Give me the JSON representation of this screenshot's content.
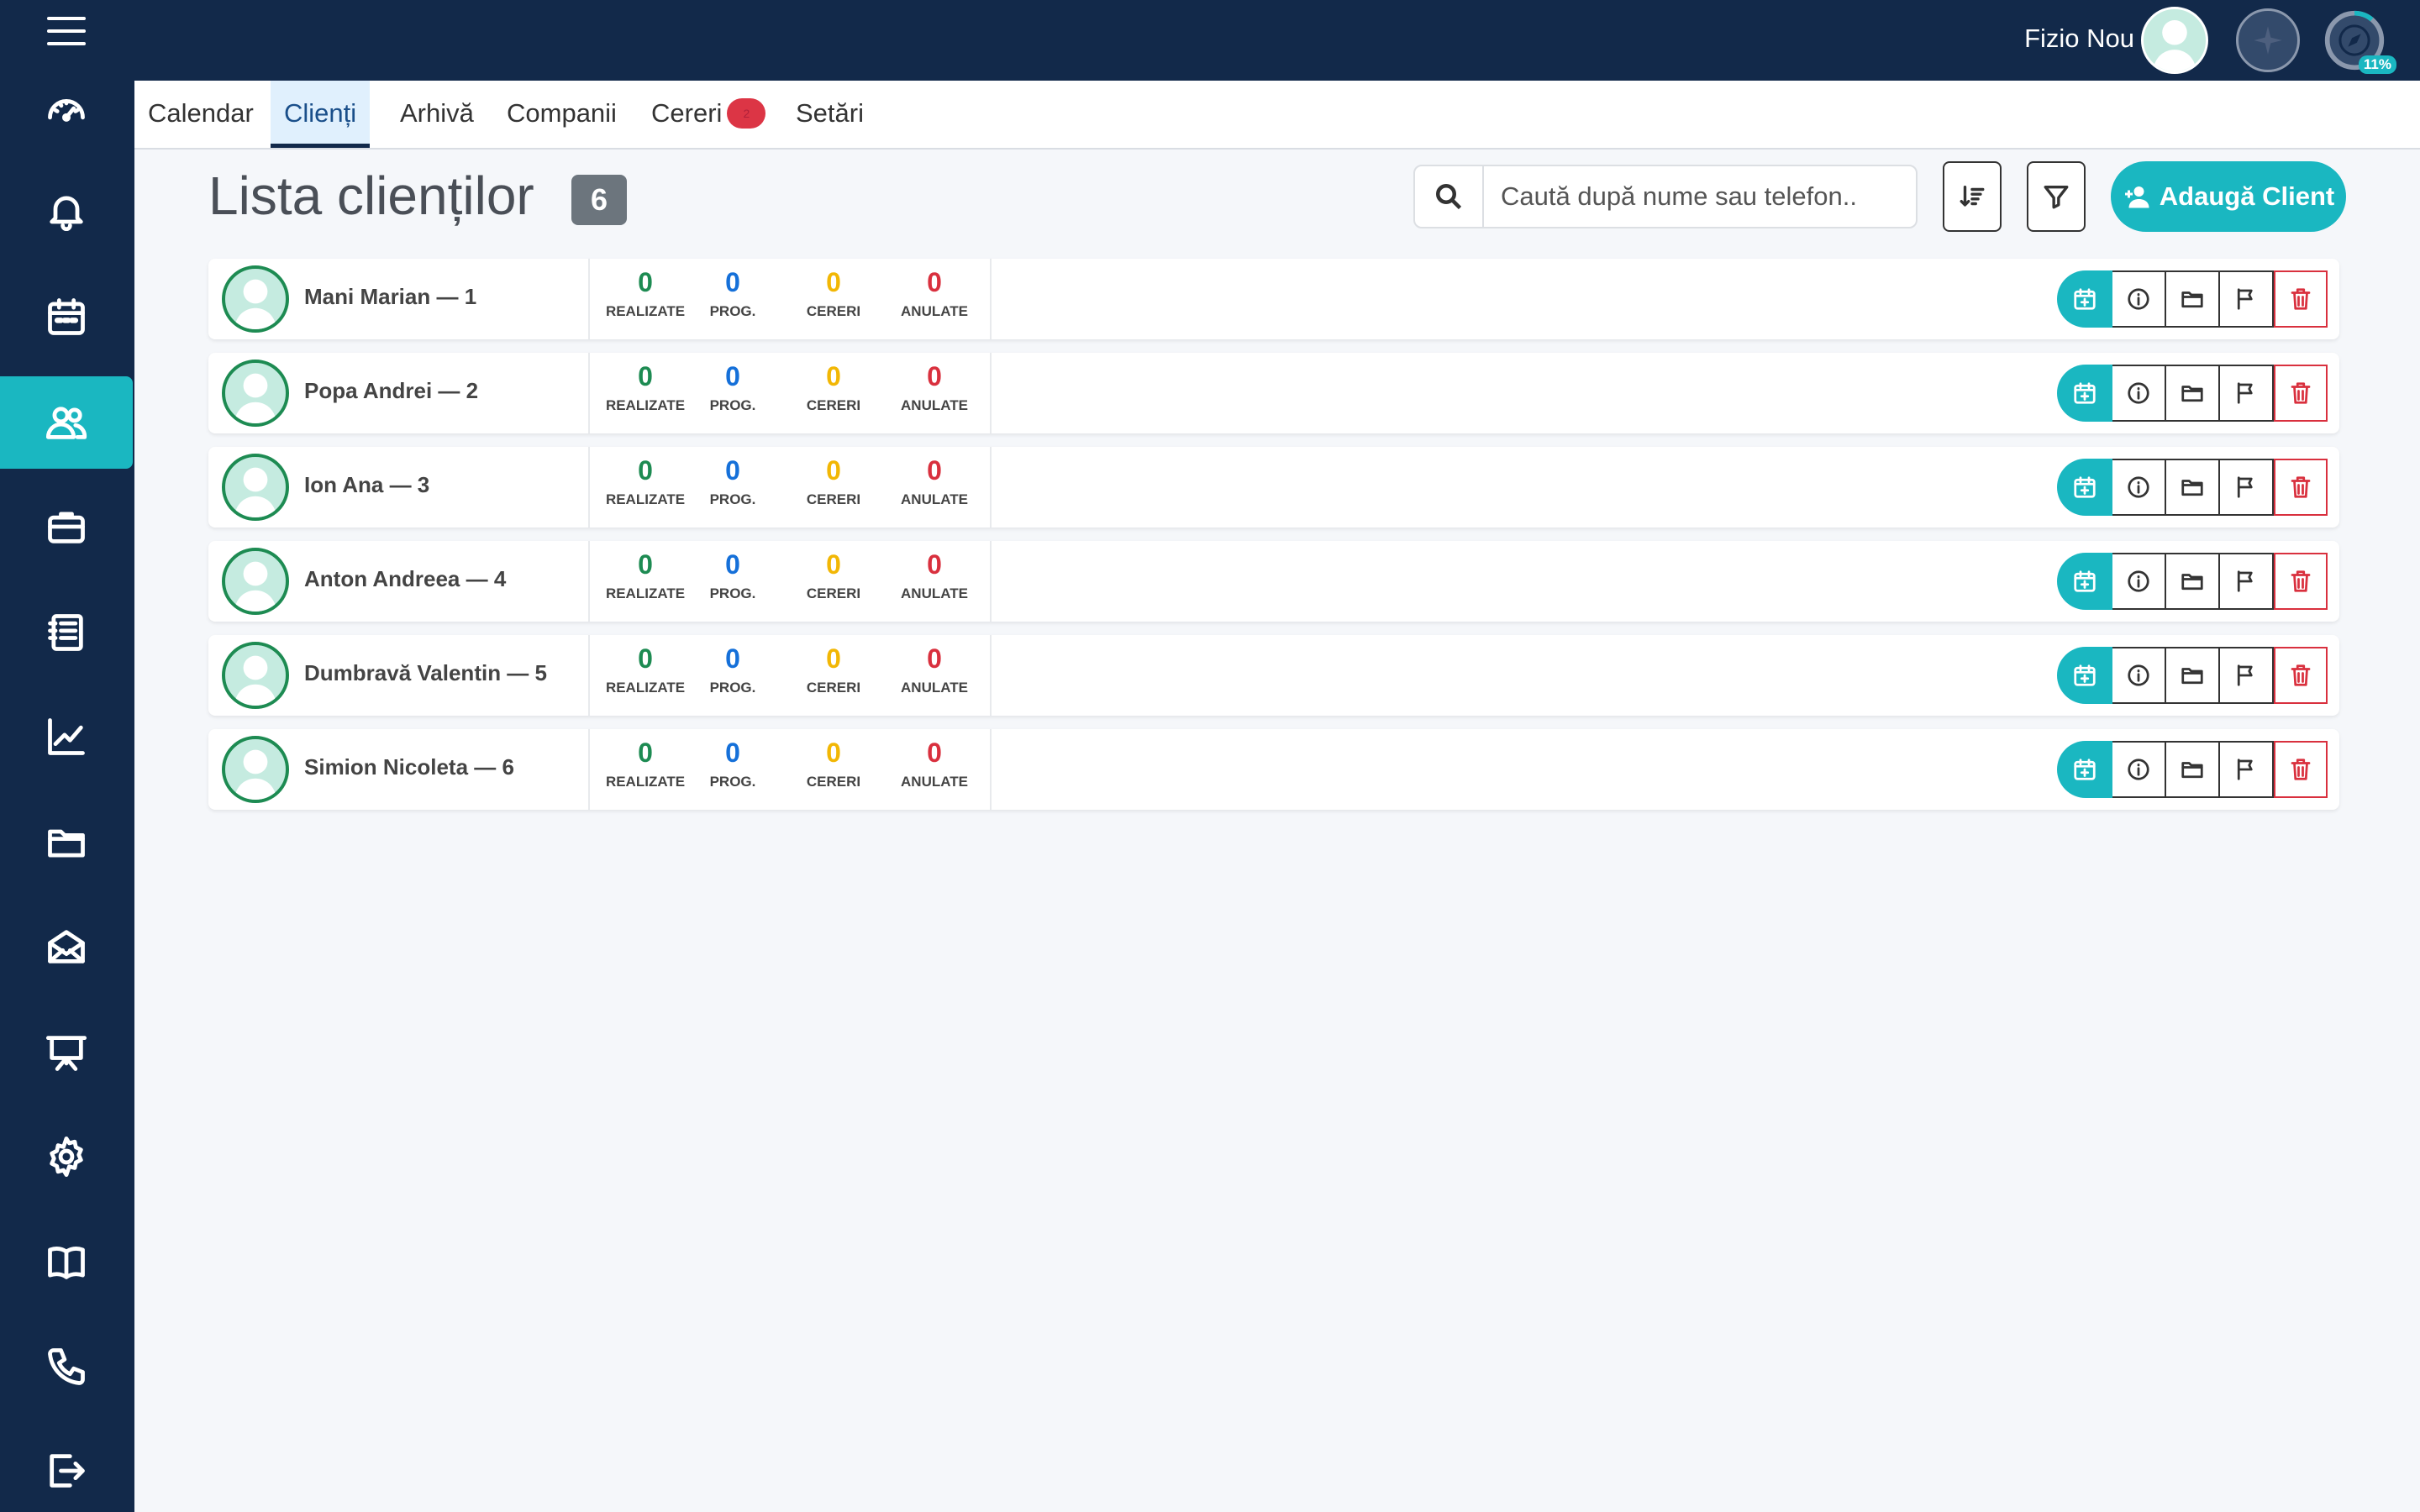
{
  "header": {
    "user_name": "Fizio Nou",
    "progress_percent": 11,
    "progress_label": "11%"
  },
  "sidebar": {
    "items": [
      {
        "name": "dashboard",
        "icon": "speedometer-icon"
      },
      {
        "name": "notifications",
        "icon": "bell-icon"
      },
      {
        "name": "calendar",
        "icon": "calendar-icon"
      },
      {
        "name": "clients",
        "icon": "people-icon",
        "active": true
      },
      {
        "name": "briefcase",
        "icon": "briefcase-icon"
      },
      {
        "name": "list",
        "icon": "list-icon"
      },
      {
        "name": "statistics",
        "icon": "chart-icon"
      },
      {
        "name": "files",
        "icon": "folder-icon"
      },
      {
        "name": "messages",
        "icon": "envelope-icon"
      },
      {
        "name": "presentation",
        "icon": "easel-icon"
      },
      {
        "name": "settings",
        "icon": "gear-icon"
      },
      {
        "name": "guide",
        "icon": "book-icon"
      },
      {
        "name": "contact",
        "icon": "phone-icon"
      },
      {
        "name": "logout",
        "icon": "logout-icon"
      }
    ]
  },
  "tabs": [
    {
      "label": "Calendar"
    },
    {
      "label": "Clienți",
      "active": true
    },
    {
      "label": "Arhivă"
    },
    {
      "label": "Companii"
    },
    {
      "label": "Cereri",
      "badge": "2"
    },
    {
      "label": "Setări"
    }
  ],
  "page": {
    "title": "Lista clienților",
    "count": "6",
    "search_placeholder": "Caută după nume sau telefon..",
    "add_button_label": "Adaugă Client"
  },
  "stat_labels": {
    "done": "REALIZATE",
    "scheduled": "PROG.",
    "requests": "CERERI",
    "cancelled": "ANULATE"
  },
  "clients": [
    {
      "name": "Mani Marian — 1",
      "done": "0",
      "scheduled": "0",
      "requests": "0",
      "cancelled": "0"
    },
    {
      "name": "Popa Andrei — 2",
      "done": "0",
      "scheduled": "0",
      "requests": "0",
      "cancelled": "0"
    },
    {
      "name": "Ion Ana — 3",
      "done": "0",
      "scheduled": "0",
      "requests": "0",
      "cancelled": "0"
    },
    {
      "name": "Anton Andreea — 4",
      "done": "0",
      "scheduled": "0",
      "requests": "0",
      "cancelled": "0"
    },
    {
      "name": "Dumbravă Valentin — 5",
      "done": "0",
      "scheduled": "0",
      "requests": "0",
      "cancelled": "0"
    },
    {
      "name": "Simion Nicoleta — 6",
      "done": "0",
      "scheduled": "0",
      "requests": "0",
      "cancelled": "0"
    }
  ],
  "colors": {
    "sidebar": "#12294a",
    "accent": "#1ab7c1",
    "done": "#1d8b52",
    "scheduled": "#1570d9",
    "requests": "#f2b705",
    "cancelled": "#d9303e"
  }
}
